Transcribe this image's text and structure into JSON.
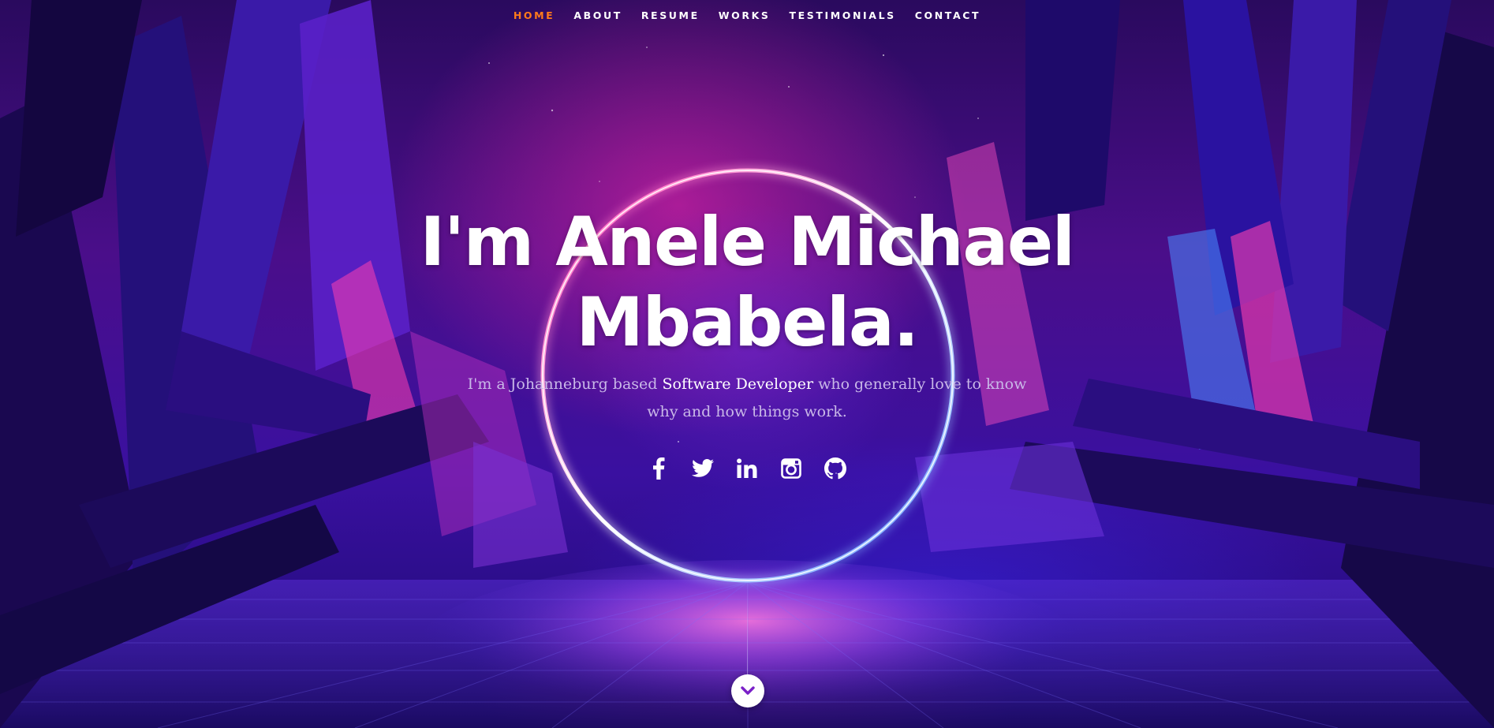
{
  "nav": {
    "items": [
      {
        "label": "HOME",
        "active": true
      },
      {
        "label": "ABOUT",
        "active": false
      },
      {
        "label": "RESUME",
        "active": false
      },
      {
        "label": "WORKS",
        "active": false
      },
      {
        "label": "TESTIMONIALS",
        "active": false
      },
      {
        "label": "CONTACT",
        "active": false
      }
    ],
    "active_color": "#ff7a1a"
  },
  "hero": {
    "headline_line1": "I'm Anele Michael",
    "headline_line2": "Mbabela.",
    "tagline_before": "I'm a Johanneburg based ",
    "tagline_emphasis": "Software Developer",
    "tagline_after": " who generally love to know why and how things work."
  },
  "socials": [
    {
      "icon": "facebook-icon"
    },
    {
      "icon": "twitter-icon"
    },
    {
      "icon": "linkedin-icon"
    },
    {
      "icon": "instagram-icon"
    },
    {
      "icon": "github-icon"
    }
  ],
  "scroll_down": {
    "icon": "chevron-down-icon"
  },
  "colors": {
    "accent": "#ff7a1a",
    "ring_pink": "#ff3fb0",
    "ring_blue": "#4f8cff",
    "background_deep": "#2a0a5e"
  }
}
